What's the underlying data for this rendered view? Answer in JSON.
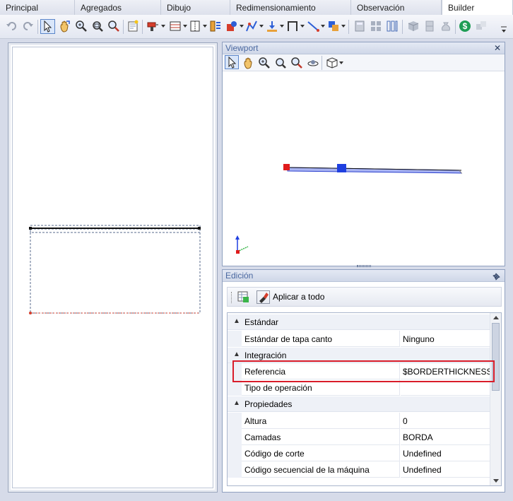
{
  "tabs": [
    {
      "label": "Principal"
    },
    {
      "label": "Agregados"
    },
    {
      "label": "Dibujo"
    },
    {
      "label": "Redimensionamiento"
    },
    {
      "label": "Observación"
    },
    {
      "label": "Builder",
      "active": true
    }
  ],
  "viewport": {
    "title": "Viewport",
    "close_glyph": "✕"
  },
  "edicion": {
    "title": "Edición",
    "pin_glyph": "📌",
    "apply_all_label": "Aplicar a todo",
    "categories": [
      {
        "name": "Estándar",
        "rows": [
          {
            "key": "Estándar de tapa canto",
            "value": "Ninguno"
          }
        ]
      },
      {
        "name": "Integración",
        "rows": [
          {
            "key": "Referencia",
            "value": "$BORDERTHICKNESSBUI"
          },
          {
            "key": "Tipo de operación",
            "value": ""
          }
        ]
      },
      {
        "name": "Propiedades",
        "rows": [
          {
            "key": "Altura",
            "value": "0"
          },
          {
            "key": "Camadas",
            "value": "BORDA"
          },
          {
            "key": "Código de corte",
            "value": "Undefined"
          },
          {
            "key": "Código secuencial de la máquina",
            "value": "Undefined"
          }
        ]
      }
    ]
  },
  "colors": {
    "highlight": "#d91d2a",
    "panel_title": "#4a68a0",
    "accent_blue": "#1f3fe0",
    "accent_red": "#e01b1b"
  }
}
